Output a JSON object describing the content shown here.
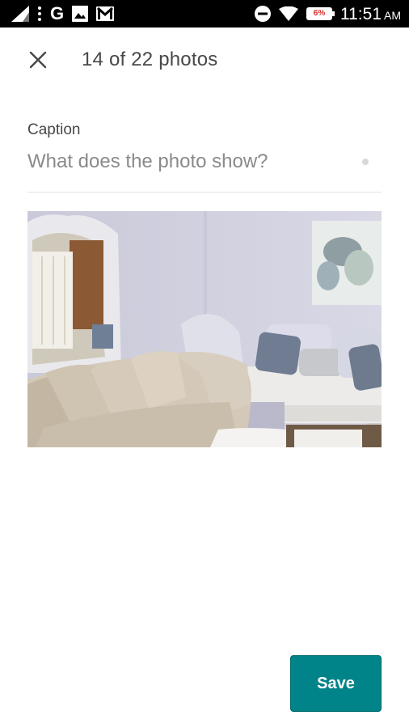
{
  "status_bar": {
    "left_icons": [
      "signal-icon",
      "more-vert-icon",
      "google-icon",
      "image-icon",
      "gmail-icon"
    ],
    "google_glyph": "G",
    "right_icons": [
      "do-not-disturb-icon",
      "wifi-icon",
      "battery-icon"
    ],
    "battery_level": "6%",
    "time": "11:51",
    "ampm": "AM"
  },
  "header": {
    "close_icon": "close-icon",
    "title": "14 of 22 photos"
  },
  "caption": {
    "label": "Caption",
    "value": "",
    "placeholder": "What does the photo show?"
  },
  "photo": {
    "subject": "living-room-photo"
  },
  "footer": {
    "save_label": "Save"
  },
  "colors": {
    "accent": "#008489",
    "text": "#484848",
    "placeholder": "#8a8a8a"
  }
}
